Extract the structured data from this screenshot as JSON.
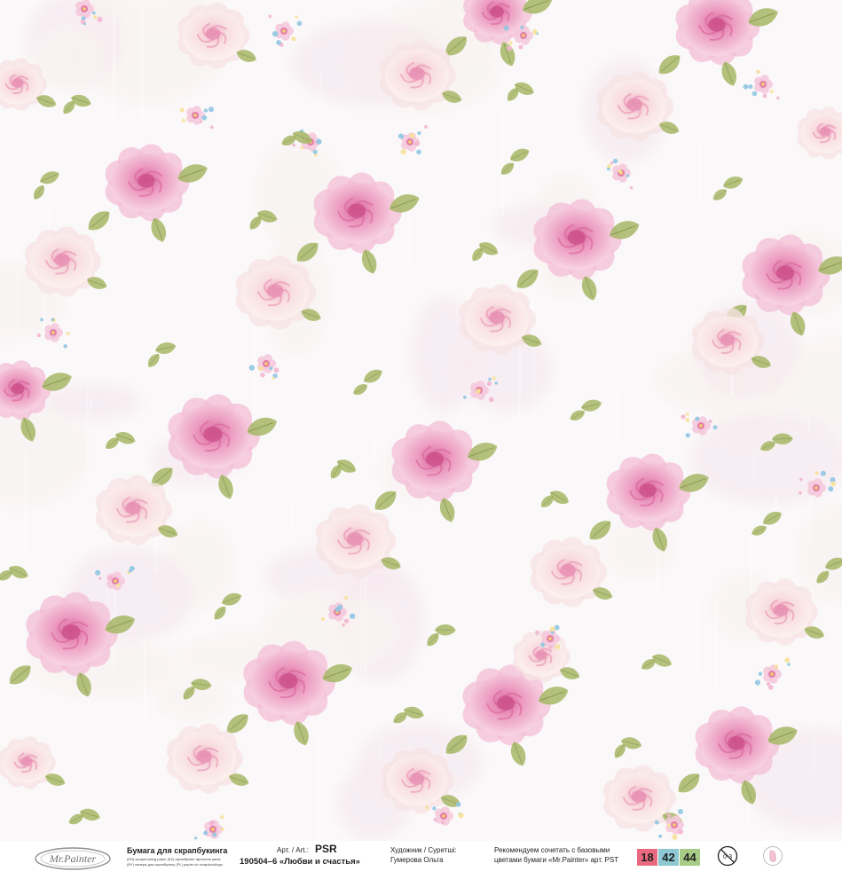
{
  "paper": {
    "pattern": "shabby-chic-roses",
    "colors": {
      "background": "#fbf8f9",
      "rose_pink": "#e98fb8",
      "rose_light": "#f4c9db",
      "rose_cream": "#fbeeee",
      "leaf": "#a9b86a",
      "forget_me_not": "#8fc6e2"
    }
  },
  "footer": {
    "logo_text": "Mr.Painter",
    "product_title": "Бумага для скрапбукинга",
    "product_sub1": "(EN) scrapbooking paper (KZ) скрапбукинг арналған қағаз",
    "product_sub2": "(BY) папера для скрапбукінгу (PL) papier do scrapbookingu",
    "art_label": "Арт. / Art.:",
    "art_code": "PSR",
    "collection": "190504–6 «Любви и счастья»",
    "artist_label": "Художник / Суретші:",
    "artist_name": "Гумерова Ольга",
    "recommend_line1": "Рекомендуем сочетать с базовыми",
    "recommend_line2": "цветами бумаги «Mr.Painter» арт. PST",
    "swatches": [
      {
        "label": "18",
        "color": "#e96a80"
      },
      {
        "label": "42",
        "color": "#8ec9d3"
      },
      {
        "label": "44",
        "color": "#a7cc87"
      }
    ],
    "icons": [
      "age-restriction-icon",
      "baby-shoe-icon"
    ]
  }
}
